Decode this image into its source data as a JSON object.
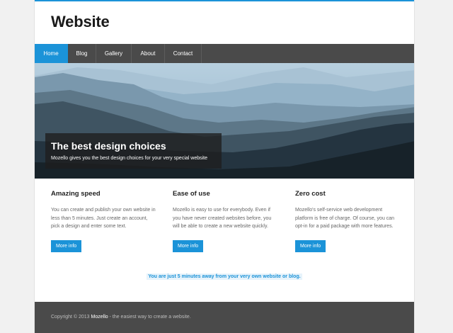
{
  "site": {
    "title": "Website"
  },
  "nav": {
    "items": [
      {
        "label": "Home",
        "active": true
      },
      {
        "label": "Blog",
        "active": false
      },
      {
        "label": "Gallery",
        "active": false
      },
      {
        "label": "About",
        "active": false
      },
      {
        "label": "Contact",
        "active": false
      }
    ]
  },
  "hero": {
    "title": "The best design choices",
    "subtitle": "Mozello gives you the best design choices for your very special website"
  },
  "features": [
    {
      "title": "Amazing speed",
      "text": "You can create and publish your own website in less than 5 minutes. Just create an account, pick a design and enter some text.",
      "button": "More info"
    },
    {
      "title": "Ease of use",
      "text": "Mozello is easy to use for everybody. Even if you have never created websites before, you will be able to create a new website quickly.",
      "button": "More info"
    },
    {
      "title": "Zero cost",
      "text": "Mozello's self-service web development platform is free of charge. Of course, you can opt-in for a paid package with more features.",
      "button": "More info"
    }
  ],
  "cta": {
    "text": "You are just 5 minutes away from your very own website or blog."
  },
  "footer": {
    "prefix": "Copyright © 2013 ",
    "brand": "Mozello",
    "suffix": " - the easiest way to create a website."
  },
  "colors": {
    "accent": "#1b93d8",
    "nav_bg": "#4a4a4a",
    "footer_bg": "#4a4a4a"
  }
}
